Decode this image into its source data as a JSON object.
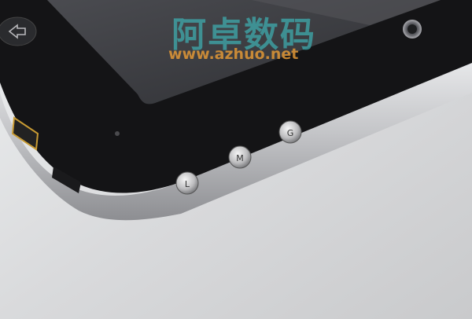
{
  "watermark": {
    "brand": "阿卓数码",
    "url": "www.azhuo.net"
  },
  "device_buttons": [
    {
      "label": "L"
    },
    {
      "label": "M"
    },
    {
      "label": "G"
    }
  ],
  "colors": {
    "background": "#d9d9db",
    "bezel": "#141416",
    "screen": "#3b3c40",
    "frame": "#c9cacc",
    "watermark_cn": "#3fafb2",
    "watermark_url": "#e89b36"
  },
  "icons": {
    "back_button": "back-arrow-icon",
    "camera": "camera-lens-icon",
    "indicator": "led-indicator-icon",
    "port": "mini-hdmi-port-icon",
    "usb": "usb-port-icon"
  }
}
